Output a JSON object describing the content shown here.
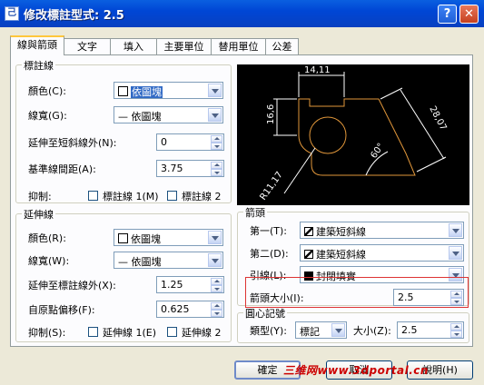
{
  "window": {
    "title": "修改標註型式: 2.5",
    "icon_glyph": "己",
    "help_glyph": "?",
    "close_glyph": "✕"
  },
  "tabs": [
    "線與箭頭",
    "文字",
    "填入",
    "主要單位",
    "替用單位",
    "公差"
  ],
  "dim_lines": {
    "group_title": "標註線",
    "color_label": "顏色(C):",
    "color_value": "依圖塊",
    "lineweight_label": "線寬(G):",
    "lineweight_value": "— 依圖塊",
    "extend_ticks_label": "延伸至短斜線外(N):",
    "extend_ticks_value": "0",
    "baseline_spacing_label": "基準線間距(A):",
    "baseline_spacing_value": "3.75",
    "suppress_label": "抑制:",
    "suppress_1": "標註線 1(M)",
    "suppress_2": "標註線 2"
  },
  "ext_lines": {
    "group_title": "延伸線",
    "color_label": "顏色(R):",
    "color_value": "依圖塊",
    "lineweight_label": "線寬(W):",
    "lineweight_value": "— 依圖塊",
    "extend_beyond_label": "延伸至標註線外(X):",
    "extend_beyond_value": "1.25",
    "offset_label": "自原點偏移(F):",
    "offset_value": "0.625",
    "suppress_label": "抑制(S):",
    "suppress_1": "延伸線 1(E)",
    "suppress_2": "延伸線 2"
  },
  "preview": {
    "dim_top": "14,11",
    "dim_left": "16,6",
    "dim_right": "28,07",
    "dim_angle": "60°",
    "dim_radius": "R11,17"
  },
  "arrowheads": {
    "group_title": "箭頭",
    "first_label": "第一(T):",
    "first_value": "建築短斜線",
    "second_label": "第二(D):",
    "second_value": "建築短斜線",
    "leader_label": "引線(L):",
    "leader_value": "封閉填實",
    "size_label": "箭頭大小(I):",
    "size_value": "2.5"
  },
  "center_marks": {
    "group_title": "圓心記號",
    "type_label": "類型(Y):",
    "type_value": "標記",
    "size_label": "大小(Z):",
    "size_value": "2.5"
  },
  "buttons": {
    "ok": "確定",
    "cancel": "取消",
    "help": "說明(H)"
  },
  "watermark": "三维网www.3dportal.cn"
}
